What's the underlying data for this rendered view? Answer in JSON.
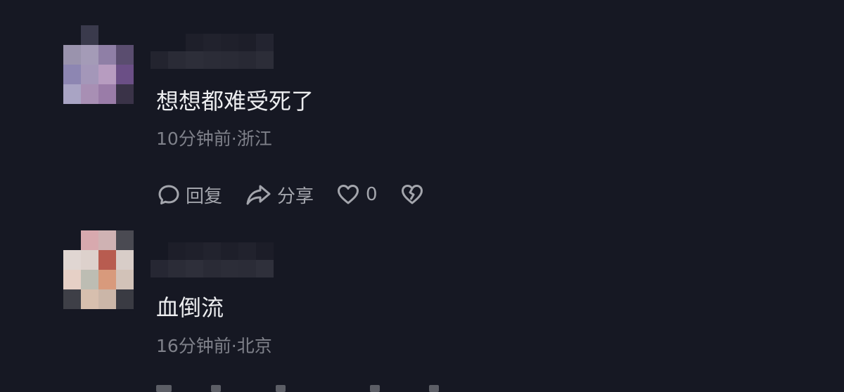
{
  "colors": {
    "background": "#161823",
    "text_primary": "#ECEDEF",
    "text_secondary": "#7F818A",
    "action_text": "#A3A5AC"
  },
  "comments": [
    {
      "text": "想想都难受死了",
      "time_location": "10分钟前·浙江",
      "avatar_icon": "pixelated-avatar",
      "username_icon": "pixelated-username",
      "actions": {
        "reply_icon": "comment-bubble-icon",
        "reply_label": "回复",
        "share_icon": "share-arrow-icon",
        "share_label": "分享",
        "like_icon": "heart-icon",
        "like_count": "0",
        "dislike_icon": "broken-heart-icon"
      }
    },
    {
      "text": "血倒流",
      "time_location": "16分钟前·北京",
      "avatar_icon": "pixelated-avatar",
      "username_icon": "pixelated-username"
    }
  ]
}
